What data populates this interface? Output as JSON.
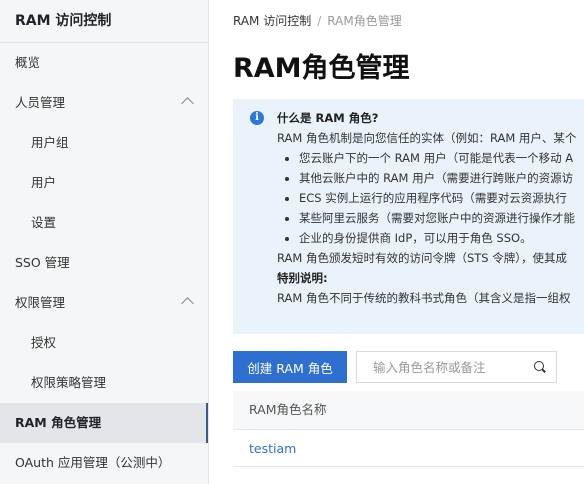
{
  "sidebar": {
    "title": "RAM 访问控制",
    "items": [
      {
        "label": "概览"
      },
      {
        "label": "人员管理"
      },
      {
        "label": "用户组"
      },
      {
        "label": "用户"
      },
      {
        "label": "设置"
      },
      {
        "label": "SSO 管理"
      },
      {
        "label": "权限管理"
      },
      {
        "label": "授权"
      },
      {
        "label": "权限策略管理"
      },
      {
        "label": "RAM 角色管理"
      },
      {
        "label": "OAuth 应用管理（公测中）"
      }
    ]
  },
  "breadcrumb": {
    "root": "RAM 访问控制",
    "separator": "/",
    "current": "RAM角色管理"
  },
  "page": {
    "title": "RAM角色管理"
  },
  "info": {
    "heading": "什么是 RAM 角色?",
    "intro": "RAM 角色机制是向您信任的实体（例如：RAM 用户、某个",
    "bullets": [
      "您云账户下的一个 RAM 用户（可能是代表一个移动 A",
      "其他云账户中的 RAM 用户（需要进行跨账户的资源访",
      "ECS 实例上运行的应用程序代码（需要对云资源执行",
      "某些阿里云服务（需要对您账户中的资源进行操作才能",
      "企业的身份提供商 IdP，可以用于角色 SSO。"
    ],
    "token_line": "RAM 角色颁发短时有效的访问令牌（STS 令牌），使其成",
    "special_heading": "特别说明:",
    "special_text": "RAM 角色不同于传统的教科书式角色（其含义是指一组权"
  },
  "toolbar": {
    "create_label": "创建 RAM 角色",
    "search_placeholder": "输入角色名称或备注",
    "search_value": ""
  },
  "table": {
    "columns": [
      "RAM角色名称"
    ],
    "rows": [
      {
        "name": "testiam"
      }
    ]
  },
  "colors": {
    "accent": "#2f6fd0",
    "info_bg": "#eaf3fc",
    "sidebar_bg": "#f5f6f7"
  }
}
